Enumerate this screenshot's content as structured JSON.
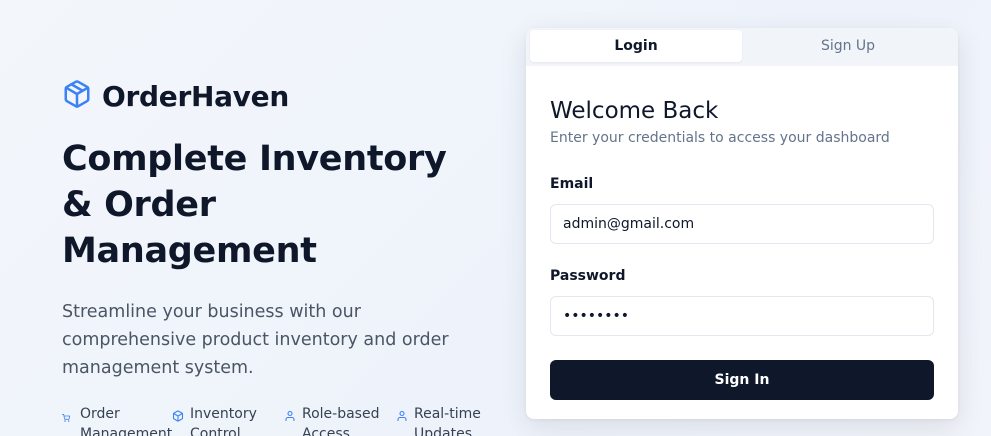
{
  "brand": {
    "name": "OrderHaven",
    "icon": "package-icon",
    "accent": "#3b82f6"
  },
  "hero": {
    "headline": "Complete Inventory & Order Management",
    "subtitle": "Streamline your business with our comprehensive product inventory and order management system."
  },
  "features": [
    {
      "label": "Order Management",
      "icon": "shopping-cart-icon"
    },
    {
      "label": "Inventory Control",
      "icon": "package-icon"
    },
    {
      "label": "Role-based Access",
      "icon": "user-icon"
    },
    {
      "label": "Real-time Updates",
      "icon": "user-icon"
    }
  ],
  "auth": {
    "tabs": [
      {
        "label": "Login",
        "active": true
      },
      {
        "label": "Sign Up",
        "active": false
      }
    ],
    "title": "Welcome Back",
    "subtitle": "Enter your credentials to access your dashboard",
    "email_label": "Email",
    "email_value": "admin@gmail.com",
    "password_label": "Password",
    "password_value": "password",
    "submit_label": "Sign In"
  },
  "colors": {
    "primary": "#0f172a",
    "accent": "#3b82f6",
    "muted": "#64748b"
  }
}
